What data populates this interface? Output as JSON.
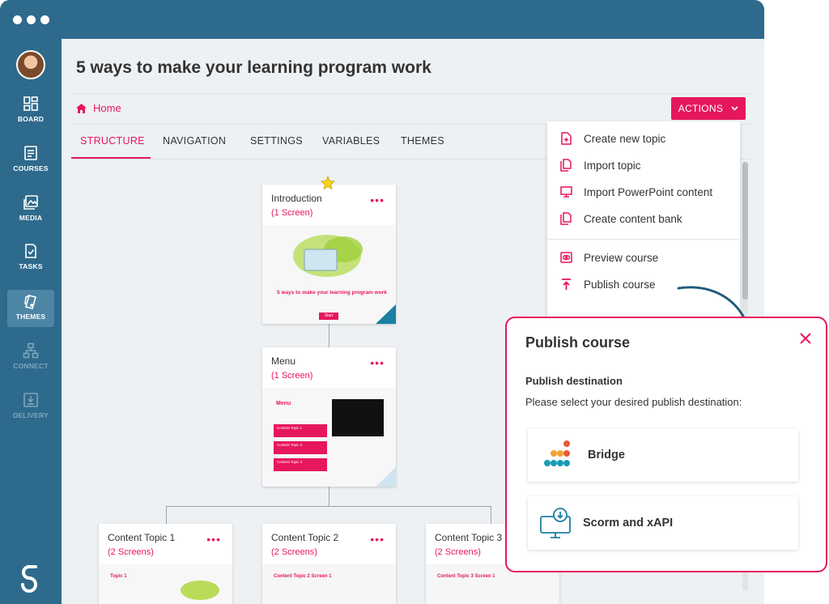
{
  "page": {
    "title": "5 ways to make your learning program work"
  },
  "sidebar": {
    "items": [
      {
        "label": "BOARD",
        "icon": "board-icon",
        "state": "normal"
      },
      {
        "label": "COURSES",
        "icon": "courses-icon",
        "state": "normal"
      },
      {
        "label": "MEDIA",
        "icon": "media-icon",
        "state": "normal"
      },
      {
        "label": "TASKS",
        "icon": "tasks-icon",
        "state": "normal"
      },
      {
        "label": "THEMES",
        "icon": "themes-icon",
        "state": "active"
      },
      {
        "label": "CONNECT",
        "icon": "connect-icon",
        "state": "disabled"
      },
      {
        "label": "DELIVERY",
        "icon": "delivery-icon",
        "state": "disabled"
      }
    ]
  },
  "breadcrumb": {
    "home": "Home"
  },
  "actions": {
    "label": "ACTIONS"
  },
  "tabs": [
    {
      "label": "STRUCTURE",
      "active": true
    },
    {
      "label": "NAVIGATION",
      "active": false
    },
    {
      "label": "SETTINGS",
      "active": false
    },
    {
      "label": "VARIABLES",
      "active": false
    },
    {
      "label": "THEMES",
      "active": false
    }
  ],
  "cards": [
    {
      "title": "Introduction",
      "subtitle": "(1 Screen)",
      "thumb_heading": "5 ways to make your learning program work",
      "thumb_button": "Start"
    },
    {
      "title": "Menu",
      "subtitle": "(1 Screen)",
      "thumb_heading": "Menu",
      "thumb_items": [
        "Content Topic 1",
        "Content Topic 2",
        "Content Topic 3"
      ]
    },
    {
      "title": "Content Topic 1",
      "subtitle": "(2 Screens)",
      "thumb_heading": "Topic 1"
    },
    {
      "title": "Content Topic 2",
      "subtitle": "(2 Screens)",
      "thumb_heading": "Content Topic 2 Screen 1"
    },
    {
      "title": "Content Topic 3",
      "subtitle": "(2 Screens)",
      "thumb_heading": "Content Topic 3 Screen 1"
    }
  ],
  "actions_menu": {
    "items": [
      {
        "label": "Create new topic",
        "icon": "add-file-icon"
      },
      {
        "label": "Import topic",
        "icon": "copy-icon"
      },
      {
        "label": "Import PowerPoint content",
        "icon": "monitor-icon"
      },
      {
        "label": "Create content bank",
        "icon": "copy-icon"
      },
      {
        "label": "Preview course",
        "icon": "eye-icon"
      },
      {
        "label": "Publish course",
        "icon": "upload-icon"
      }
    ]
  },
  "publish_dialog": {
    "title": "Publish course",
    "section_label": "Publish destination",
    "description": "Please select your desired publish destination:",
    "options": [
      {
        "label": "Bridge",
        "icon": "bridge-logo-icon"
      },
      {
        "label": "Scorm and xAPI",
        "icon": "download-monitor-icon"
      }
    ]
  },
  "colors": {
    "brand": "#e6175c",
    "sidebar": "#2e6a8c",
    "teal": "#1a9bb5"
  }
}
